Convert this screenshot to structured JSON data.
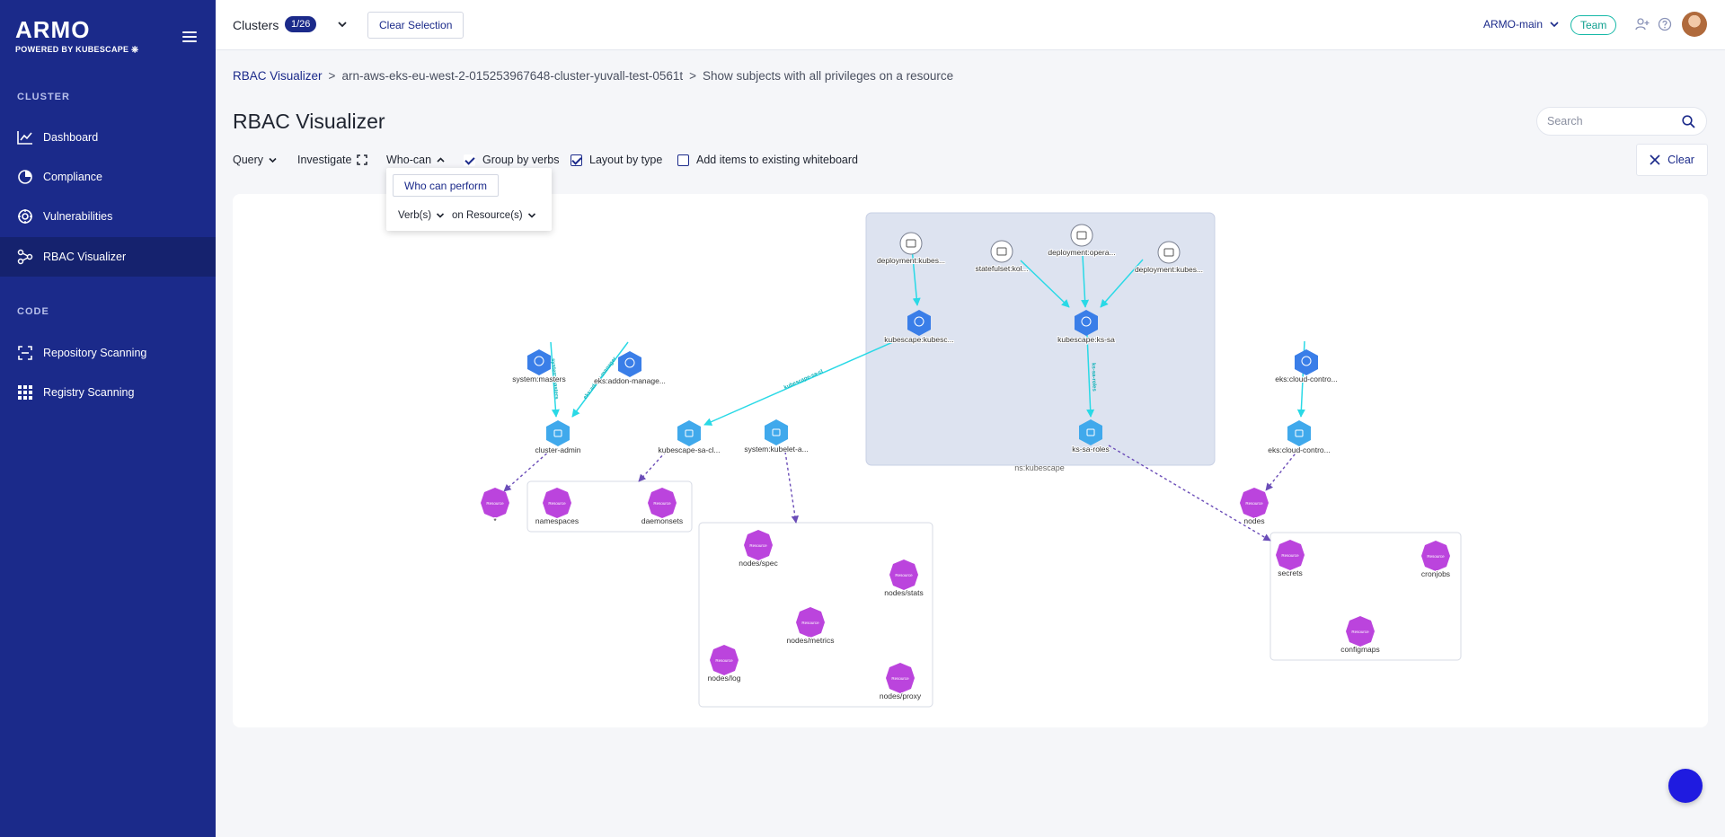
{
  "brand": {
    "name": "ARMO",
    "tagline": "POWERED BY KUBESCAPE"
  },
  "sidebar": {
    "sections": [
      {
        "title": "CLUSTER",
        "items": [
          {
            "label": "Dashboard",
            "icon": "dashboard-icon"
          },
          {
            "label": "Compliance",
            "icon": "compliance-icon"
          },
          {
            "label": "Vulnerabilities",
            "icon": "vulnerabilities-icon"
          },
          {
            "label": "RBAC Visualizer",
            "icon": "rbac-icon",
            "active": true
          }
        ]
      },
      {
        "title": "CODE",
        "items": [
          {
            "label": "Repository Scanning",
            "icon": "repository-icon"
          },
          {
            "label": "Registry Scanning",
            "icon": "registry-icon"
          }
        ]
      }
    ]
  },
  "topbar": {
    "clusters_label": "Clusters",
    "clusters_count": "1/26",
    "clear_selection": "Clear Selection",
    "org": "ARMO-main",
    "team": "Team"
  },
  "breadcrumb": {
    "root": "RBAC Visualizer",
    "cluster": "arn-aws-eks-eu-west-2-015253967648-cluster-yuvall-test-0561t",
    "current": "Show subjects with all privileges on a resource",
    "separator": ">"
  },
  "page": {
    "title": "RBAC Visualizer"
  },
  "search": {
    "placeholder": "Search"
  },
  "toolbar": {
    "query": "Query",
    "investigate": "Investigate",
    "who_can": "Who-can",
    "group_by_verbs": "Group by verbs",
    "group_by_verbs_checked": true,
    "layout_by_type": "Layout by type",
    "layout_by_type_checked": true,
    "add_to_whiteboard": "Add items to existing whiteboard",
    "add_to_whiteboard_checked": false,
    "clear": "Clear"
  },
  "who_can_dropdown": {
    "button": "Who can perform",
    "verbs": "Verb(s)",
    "resources": "on Resource(s)"
  },
  "graph": {
    "namespace_label": "ns:kubescape",
    "colors": {
      "subject": "#3a7ee8",
      "role": "#40a9ec",
      "resource": "#bb44dd",
      "sa": "#ffffff",
      "edge_cyan": "#29d9e6",
      "edge_purple": "#6b4db8",
      "group_bg": "#dde3f0"
    },
    "nodes": [
      {
        "id": "n1",
        "type": "workload",
        "label": "deployment:kubes..."
      },
      {
        "id": "n2",
        "type": "workload",
        "label": "statefulset:kol..."
      },
      {
        "id": "n3",
        "type": "workload",
        "label": "deployment:opera..."
      },
      {
        "id": "n4",
        "type": "workload",
        "label": "deployment:kubes..."
      },
      {
        "id": "n5",
        "type": "subject",
        "label": "kubescape:kubesc..."
      },
      {
        "id": "n6",
        "type": "subject",
        "label": "kubescape:ks-sa"
      },
      {
        "id": "n7",
        "type": "role",
        "label": "ks-sa-roles"
      },
      {
        "id": "n8",
        "type": "subject",
        "label": "system:masters"
      },
      {
        "id": "n9",
        "type": "subject",
        "label": "eks:addon-manage..."
      },
      {
        "id": "n10",
        "type": "role",
        "label": "cluster-admin"
      },
      {
        "id": "n11",
        "type": "role",
        "label": "kubescape-sa-cl..."
      },
      {
        "id": "n12",
        "type": "role",
        "label": "system:kubelet-a..."
      },
      {
        "id": "n13",
        "type": "subject",
        "label": "eks:cloud-contro..."
      },
      {
        "id": "n14",
        "type": "role",
        "label": "eks:cloud-contro..."
      },
      {
        "id": "r1",
        "type": "resource",
        "label": "*"
      },
      {
        "id": "r2",
        "type": "resource",
        "label": "namespaces"
      },
      {
        "id": "r3",
        "type": "resource",
        "label": "daemonsets"
      },
      {
        "id": "r4",
        "type": "resource",
        "label": "nodes/spec"
      },
      {
        "id": "r5",
        "type": "resource",
        "label": "nodes/stats"
      },
      {
        "id": "r6",
        "type": "resource",
        "label": "nodes/metrics"
      },
      {
        "id": "r7",
        "type": "resource",
        "label": "nodes/log"
      },
      {
        "id": "r8",
        "type": "resource",
        "label": "nodes/proxy"
      },
      {
        "id": "r9",
        "type": "resource",
        "label": "nodes"
      },
      {
        "id": "r10",
        "type": "resource",
        "label": "secrets"
      },
      {
        "id": "r11",
        "type": "resource",
        "label": "cronjobs"
      },
      {
        "id": "r12",
        "type": "resource",
        "label": "configmaps"
      }
    ],
    "edge_labels": {
      "edge_5_11": "kubescape-sa-cl",
      "edge_6_7": "ks-sa-roles",
      "edge_8_10": "system:masters",
      "edge_9_10": "eks:addon-manager"
    },
    "node_badge": "Resource"
  }
}
